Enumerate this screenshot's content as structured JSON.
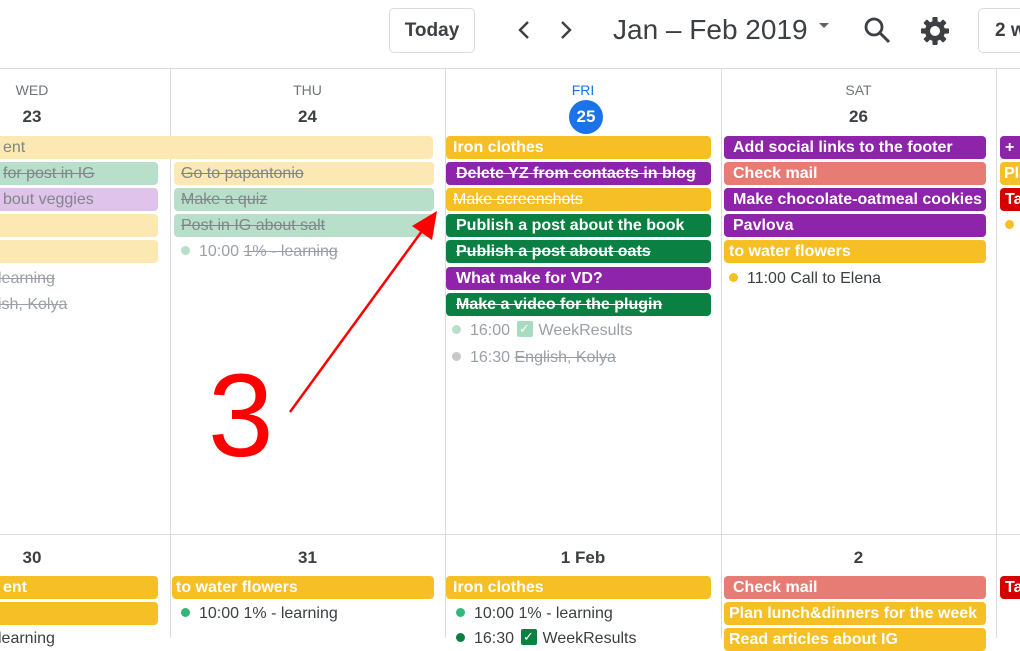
{
  "toolbar": {
    "today_label": "Today",
    "period_label": "Jan – Feb 2019",
    "view_label": "2 w"
  },
  "week1": {
    "days": [
      {
        "dow": "WED",
        "num": "23"
      },
      {
        "dow": "THU",
        "num": "24"
      },
      {
        "dow": "FRI",
        "num": "25"
      },
      {
        "dow": "SAT",
        "num": "26"
      }
    ],
    "span_event": "ent",
    "wed": [
      "for post in IG",
      "bout veggies",
      "learning",
      "ish, Kolya"
    ],
    "thu": [
      "Go to papantonio",
      "Make a quiz",
      "Post in IG about salt",
      "10:00",
      "1% - learning"
    ],
    "fri": [
      "Iron clothes",
      "Delete YZ from contacts in blog",
      "Make screenshots",
      "Publish a post about the book",
      "Publish a post about oats",
      "What make for VD?",
      "Make a video for the plugin",
      "16:00",
      "WeekResults",
      "16:30",
      "English, Kolya"
    ],
    "sat": [
      "Add social links to the footer",
      "Check mail",
      "Make chocolate-oatmeal cookies",
      "Pavlova",
      "to water flowers",
      "11:00",
      "Call to Elena"
    ],
    "sun": [
      "+",
      "Pla",
      "Ta"
    ]
  },
  "week2": {
    "days": [
      {
        "num": "30"
      },
      {
        "num": "31"
      },
      {
        "num": "1 Feb"
      },
      {
        "num": "2"
      }
    ],
    "wed": [
      "ent",
      "learning"
    ],
    "thu": [
      "to water flowers",
      "10:00",
      "1% - learning"
    ],
    "fri": [
      "Iron clothes",
      "10:00",
      "1% - learning",
      "16:30",
      "WeekResults"
    ],
    "sat": [
      "Check mail",
      "Plan lunch&dinners for the week",
      "Read articles about IG"
    ],
    "sun": [
      "Ta"
    ]
  },
  "annotation": {
    "label": "3",
    "color": "#ff0000"
  },
  "colors": {
    "banana": "#f6bf26",
    "banana_pale": "#fce8b2",
    "sage_pale": "#b7dfc9",
    "grape": "#8e24aa",
    "grape_pale": "#dfc3ea",
    "basil": "#0b8043",
    "flamingo": "#e67c73",
    "tomato": "#d50000",
    "today_blue": "#1a73e8"
  },
  "icons": [
    "chevron-left-icon",
    "chevron-right-icon",
    "dropdown-caret-icon",
    "search-icon",
    "settings-gear-icon",
    "checkbox-icon"
  ]
}
